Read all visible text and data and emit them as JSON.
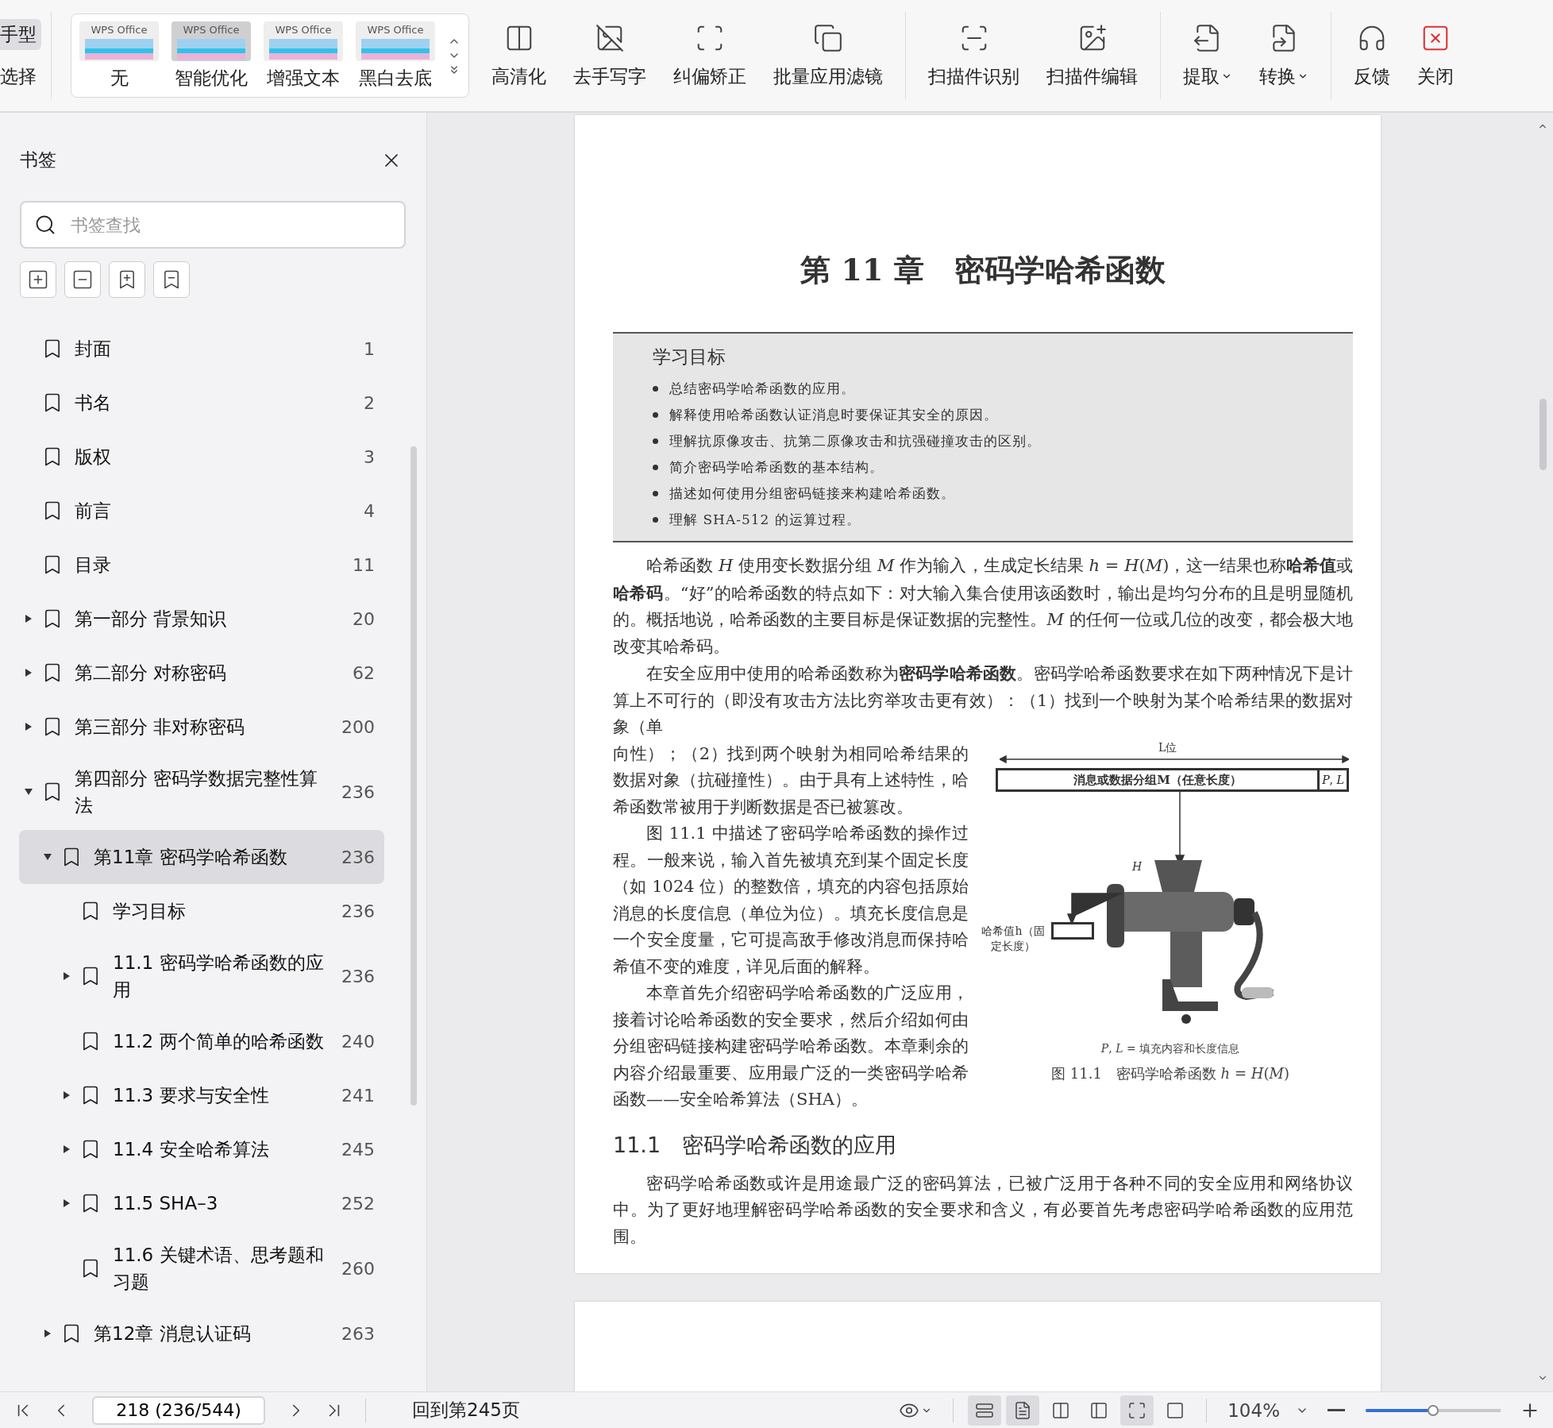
{
  "toolbar": {
    "left_tools": [
      {
        "label": "手型",
        "selected": true
      },
      {
        "label": "选择",
        "selected": false
      }
    ],
    "filters": [
      {
        "thumb_text": "WPS Office",
        "label": "无",
        "selected": false
      },
      {
        "thumb_text": "WPS Office",
        "label": "智能优化",
        "selected": true
      },
      {
        "thumb_text": "WPS Office",
        "label": "增强文本",
        "selected": false
      },
      {
        "thumb_text": "WPS Office",
        "label": "黑白去底",
        "selected": false
      }
    ],
    "tool_groups": [
      [
        {
          "label": "高清化",
          "has_menu": false
        },
        {
          "label": "去手写字",
          "has_menu": false
        },
        {
          "label": "纠偏矫正",
          "has_menu": false
        },
        {
          "label": "批量应用滤镜",
          "has_menu": false
        }
      ],
      [
        {
          "label": "扫描件识别",
          "has_menu": false
        },
        {
          "label": "扫描件编辑",
          "has_menu": false
        }
      ],
      [
        {
          "label": "提取",
          "has_menu": true
        },
        {
          "label": "转换",
          "has_menu": true
        }
      ],
      [
        {
          "label": "反馈",
          "has_menu": false
        },
        {
          "label": "关闭",
          "has_menu": false
        }
      ]
    ]
  },
  "sidebar": {
    "title": "书签",
    "search": {
      "placeholder": "书签查找"
    },
    "bookmarks": [
      {
        "label": "封面",
        "page": "1",
        "selected": false
      },
      {
        "label": "书名",
        "page": "2",
        "selected": false
      },
      {
        "label": "版权",
        "page": "3",
        "selected": false
      },
      {
        "label": "前言",
        "page": "4",
        "selected": false
      },
      {
        "label": "目录",
        "page": "11",
        "selected": false
      },
      {
        "label": "第一部分 背景知识",
        "page": "20",
        "selected": false,
        "expanded": false
      },
      {
        "label": "第二部分 对称密码",
        "page": "62",
        "selected": false,
        "expanded": false
      },
      {
        "label": "第三部分 非对称密码",
        "page": "200",
        "selected": false,
        "expanded": false
      },
      {
        "label": "第四部分 密码学数据完整性算法",
        "page": "236",
        "selected": false,
        "expanded": true,
        "children": [
          {
            "label": "第11章 密码学哈希函数",
            "page": "236",
            "selected": true,
            "expanded": true,
            "children": [
              {
                "label": "学习目标",
                "page": "236",
                "selected": false
              },
              {
                "label": "11.1 密码学哈希函数的应用",
                "page": "236",
                "selected": false,
                "expanded": false
              },
              {
                "label": "11.2 两个简单的哈希函数",
                "page": "240",
                "selected": false
              },
              {
                "label": "11.3 要求与安全性",
                "page": "241",
                "selected": false,
                "expanded": false
              },
              {
                "label": "11.4 安全哈希算法",
                "page": "245",
                "selected": false,
                "expanded": false
              },
              {
                "label": "11.5 SHA–3",
                "page": "252",
                "selected": false,
                "expanded": false
              },
              {
                "label": "11.6 关键术语、思考题和习题",
                "page": "260",
                "selected": false
              }
            ]
          },
          {
            "label": "第12章 消息认证码",
            "page": "263",
            "selected": false,
            "expanded": false
          }
        ]
      }
    ]
  },
  "document": {
    "chapter_title": "第 11 章　密码学哈希函数",
    "objectives": {
      "title": "学习目标",
      "items": [
        "总结密码学哈希函数的应用。",
        "解释使用哈希函数认证消息时要保证其安全的原因。",
        "理解抗原像攻击、抗第二原像攻击和抗强碰撞攻击的区别。",
        "简介密码学哈希函数的基本结构。",
        "描述如何使用分组密码链接来构建哈希函数。",
        "理解 SHA-512 的运算过程。"
      ]
    },
    "paragraphs": [
      "哈希函数 *H* 使用变长数据分组 *M* 作为输入，生成定长结果 *h* = *H*(*M*)，这一结果也称**哈希值**或**哈希码**。“好”的哈希函数的特点如下：对大输入集合使用该函数时，输出是均匀分布的且是明显随机的。概括地说，哈希函数的主要目标是保证数据的完整性。*M* 的任何一位或几位的改变，都会极大地改变其哈希码。",
      "在安全应用中使用的哈希函数称为**密码学哈希函数**。密码学哈希函数要求在如下两种情况下是计算上不可行的（即没有攻击方法比穷举攻击更有效）：（1）找到一个映射为某个哈希结果的数据对象（单"
    ],
    "column_paragraphs": [
      "向性）；（2）找到两个映射为相同哈希结果的数据对象（抗碰撞性）。由于具有上述特性，哈希函数常被用于判断数据是否已被篡改。",
      "图 11.1 中描述了密码学哈希函数的操作过程。一般来说，输入首先被填充到某个固定长度（如 1024 位）的整数倍，填充的内容包括原始消息的长度信息（单位为位）。填充长度信息是一个安全度量，它可提高敌手修改消息而保持哈希值不变的难度，详见后面的解释。",
      "本章首先介绍密码学哈希函数的广泛应用，接着讨论哈希函数的安全要求，然后介绍如何由分组密码链接构建密码学哈希函数。本章剩余的内容介绍最重要、应用最广泛的一类密码学哈希函数——安全哈希算法（SHA）。"
    ],
    "figure": {
      "length_label": "L位",
      "message_label": "消息或数据分组M（任意长度）",
      "padding_label": "*P*, *L*",
      "function_label": "*H*",
      "output_label": "哈希值h（固定长度）",
      "note": "*P*, *L* = 填充内容和长度信息",
      "caption": "图 11.1　密码学哈希函数 *h* = *H*(*M*)"
    },
    "section_title": "11.1　密码学哈希函数的应用",
    "section_paragraph": "密码学哈希函数或许是用途最广泛的密码算法，已被广泛用于各种不同的安全应用和网络协议中。为了更好地理解密码学哈希函数的安全要求和含义，有必要首先考虑密码学哈希函数的应用范围。"
  },
  "status_bar": {
    "page_field": "218 (236/544)",
    "goto_link": "回到第245页",
    "view_buttons": [
      {
        "selected": true
      },
      {
        "selected": true
      },
      {
        "selected": false
      },
      {
        "selected": false
      },
      {
        "selected": true
      },
      {
        "selected": false
      }
    ],
    "zoom": "104%",
    "zoom_slider": {
      "level": 0.5
    }
  }
}
